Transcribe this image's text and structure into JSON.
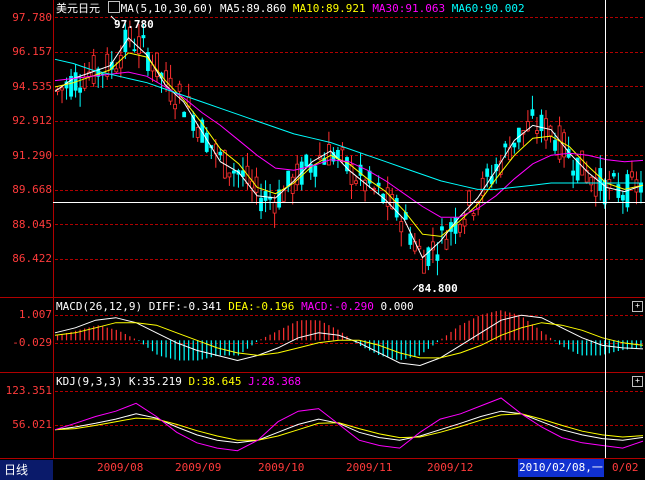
{
  "main_panel": {
    "symbol": "美元日元",
    "ma_label": "MA(5,10,30,60)",
    "ma5": "MA5:89.860",
    "ma10": "MA10:89.921",
    "ma30": "MA30:91.063",
    "ma60": "MA60:90.002",
    "high_marker": "97.780",
    "low_marker": "84.800",
    "y_ticks": [
      "97.780",
      "96.157",
      "94.535",
      "92.912",
      "91.290",
      "89.668",
      "88.045",
      "86.422"
    ],
    "y_range": [
      84.8,
      97.78
    ]
  },
  "macd_panel": {
    "label": "MACD(26,12,9)",
    "diff": "DIFF:-0.341",
    "dea": "DEA:-0.196",
    "macd": "MACD:-0.290",
    "zero": "0.000",
    "y_ticks": [
      "1.007",
      "-0.029"
    ]
  },
  "kdj_panel": {
    "label": "KDJ(9,3,3)",
    "k": "K:35.219",
    "d": "D:38.645",
    "j": "J:28.368",
    "y_ticks": [
      "123.351",
      "56.021"
    ]
  },
  "footer": {
    "period": "日线",
    "dates": [
      "2009/08",
      "2009/09",
      "2009/10",
      "2009/11",
      "2009/12"
    ],
    "cursor_date": "2010/02/08,一",
    "cursor_tail": "0/02"
  },
  "colors": {
    "up": "#ff3030",
    "down": "#00ffff",
    "ma5": "#ffffff",
    "ma10": "#ffff00",
    "ma30": "#ff00ff",
    "ma60": "#00ffff",
    "axis": "#ff3b3b",
    "grid": "#b00000"
  },
  "chart_data": [
    {
      "type": "line",
      "title": "美元日元 MA(5,10,30,60)",
      "series": [
        {
          "name": "MA5",
          "values": [
            94.3,
            94.9,
            95.2,
            95.5,
            96.8,
            96.0,
            94.6,
            93.8,
            92.4,
            91.0,
            90.5,
            89.4,
            89.3,
            90.1,
            91.0,
            91.5,
            90.6,
            89.9,
            89.2,
            88.3,
            86.5,
            87.3,
            88.4,
            89.3,
            90.6,
            92.0,
            92.7,
            92.5,
            91.4,
            90.5,
            89.8,
            89.6,
            89.9
          ]
        },
        {
          "name": "MA10",
          "values": [
            94.5,
            94.7,
            95.0,
            95.3,
            96.1,
            95.9,
            94.8,
            93.9,
            92.8,
            91.6,
            90.9,
            89.8,
            89.5,
            90.0,
            90.8,
            91.3,
            90.9,
            90.2,
            89.6,
            88.7,
            87.6,
            87.5,
            88.2,
            89.0,
            90.2,
            91.3,
            92.1,
            92.2,
            91.7,
            90.8,
            90.0,
            89.7,
            89.9
          ]
        },
        {
          "name": "MA30",
          "values": [
            94.8,
            94.9,
            95.0,
            95.1,
            95.2,
            95.0,
            94.5,
            94.0,
            93.3,
            92.7,
            92.0,
            91.3,
            90.7,
            90.6,
            90.8,
            91.1,
            91.0,
            90.6,
            90.1,
            89.5,
            88.9,
            88.4,
            88.4,
            88.8,
            89.4,
            90.2,
            90.9,
            91.3,
            91.4,
            91.3,
            91.1,
            91.0,
            91.06
          ]
        },
        {
          "name": "MA60",
          "values": [
            95.8,
            95.6,
            95.3,
            95.1,
            94.9,
            94.7,
            94.4,
            94.1,
            93.8,
            93.5,
            93.2,
            92.9,
            92.6,
            92.3,
            92.1,
            91.9,
            91.6,
            91.3,
            91.0,
            90.7,
            90.4,
            90.1,
            89.9,
            89.7,
            89.7,
            89.8,
            89.9,
            90.0,
            90.0,
            90.0,
            90.0,
            90.0,
            90.0
          ]
        }
      ],
      "ylim": [
        84.8,
        97.78
      ]
    },
    {
      "type": "bar",
      "title": "MACD(26,12,9)",
      "series": [
        {
          "name": "DIFF",
          "values": [
            0.3,
            0.5,
            0.8,
            0.9,
            0.7,
            0.3,
            -0.1,
            -0.4,
            -0.6,
            -0.8,
            -0.6,
            -0.3,
            0.1,
            0.3,
            0.2,
            -0.1,
            -0.5,
            -0.9,
            -1.0,
            -0.7,
            -0.2,
            0.3,
            0.8,
            1.0,
            0.9,
            0.5,
            0.1,
            -0.2,
            -0.3,
            -0.34
          ]
        },
        {
          "name": "DEA",
          "values": [
            0.2,
            0.3,
            0.5,
            0.7,
            0.7,
            0.6,
            0.3,
            0.0,
            -0.3,
            -0.5,
            -0.6,
            -0.5,
            -0.3,
            -0.1,
            0.0,
            0.0,
            -0.2,
            -0.5,
            -0.7,
            -0.7,
            -0.5,
            -0.2,
            0.2,
            0.5,
            0.7,
            0.6,
            0.4,
            0.1,
            -0.1,
            -0.196
          ]
        }
      ],
      "ylim": [
        -1.1,
        1.007
      ]
    },
    {
      "type": "line",
      "title": "KDJ(9,3,3)",
      "series": [
        {
          "name": "K",
          "values": [
            50,
            55,
            62,
            70,
            80,
            72,
            55,
            40,
            30,
            25,
            30,
            45,
            60,
            70,
            62,
            45,
            35,
            30,
            38,
            50,
            62,
            75,
            85,
            80,
            65,
            50,
            40,
            33,
            30,
            35.219
          ]
        },
        {
          "name": "D",
          "values": [
            50,
            52,
            58,
            65,
            72,
            70,
            60,
            48,
            38,
            30,
            30,
            38,
            50,
            62,
            63,
            52,
            42,
            35,
            36,
            45,
            56,
            68,
            78,
            80,
            70,
            58,
            47,
            40,
            36,
            38.645
          ]
        },
        {
          "name": "J",
          "values": [
            50,
            62,
            75,
            85,
            100,
            75,
            45,
            25,
            15,
            10,
            30,
            65,
            85,
            90,
            60,
            30,
            20,
            15,
            45,
            70,
            80,
            95,
            110,
            80,
            55,
            35,
            25,
            20,
            15,
            28.368
          ]
        }
      ],
      "ylim": [
        0,
        123.351
      ]
    }
  ]
}
